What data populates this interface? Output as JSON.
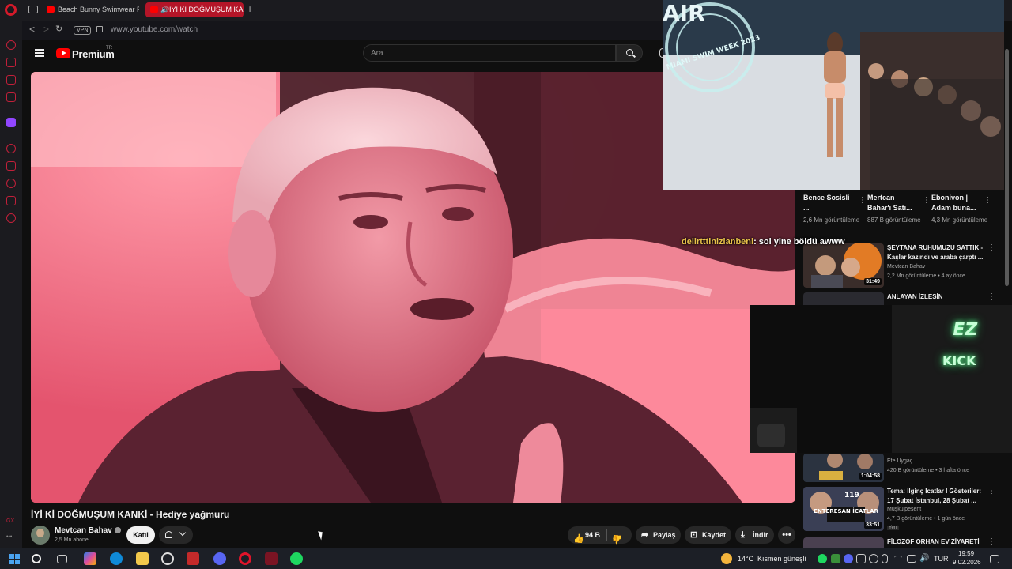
{
  "browser": {
    "tabs": [
      {
        "label": "Beach Bunny Swimwear Fa"
      },
      {
        "label": "İYİ Kİ DOĞMUŞUM KAN"
      }
    ],
    "vpn_label": "VPN",
    "url": "www.youtube.com/watch",
    "sidebar_labels": {
      "gx": "GX"
    }
  },
  "youtube": {
    "logo_text": "Premium",
    "logo_region": "TR",
    "search_placeholder": "Ara"
  },
  "video": {
    "title": "İYİ Kİ DOĞMUŞUM KANKİ - Hediye yağmuru",
    "channel": "Mevtcan Bahav",
    "subscribers": "2,5 Mn abone",
    "join_label": "Katıl",
    "likes": "94 B",
    "share_label": "Paylaş",
    "save_label": "Kaydet",
    "download_label": "İndir"
  },
  "shorts": [
    {
      "title": "Bence Sosisli ...",
      "views": "2,6 Mn görüntüleme"
    },
    {
      "title": "Mertcan Bahar'ı Satı...",
      "views": "887 B görüntüleme"
    },
    {
      "title": "Ebonivon | Adam buna...",
      "views": "4,3 Mn görüntüleme"
    }
  ],
  "recommendations": [
    {
      "title": "ŞEYTANA RUHUMUZU SATTIK - Kaşlar kazındı ve araba çarptı ...",
      "channel": "Mevtcan Bahav",
      "meta": "2,2 Mn görüntüleme • 4 ay önce",
      "duration": "31:49"
    },
    {
      "title": "ANLAYAN İZLESİN",
      "channel": "",
      "meta": "",
      "duration": ""
    },
    {
      "title": "",
      "channel": "Efe Uygaç",
      "meta": "420 B görüntüleme • 3 hafta önce",
      "duration": "1:04:58"
    },
    {
      "title": "Tema: İlginç İcatlar I Gösteriler: 17 Şubat İstanbul, 28 Şubat ...",
      "channel": "Müşkülpesent",
      "meta": "4,7 B görüntüleme • 1 gün önce",
      "badge": "Yeni",
      "duration": "33:51",
      "thumb_text": "ENTERESAN İCATLAR",
      "thumb_number": "119"
    },
    {
      "title": "FİLOZOF ORHAN EV ZİYARETİ",
      "channel": "",
      "meta": "",
      "duration": ""
    }
  ],
  "overlays": {
    "chat_user": "delirtttinizlanbeni",
    "chat_message": ": sol yine böldü awww",
    "cam_ez": "EZ",
    "cam_kick": "KICK",
    "pip_text": "AIR",
    "pip_stamp": "MIAMI SWIM WEEK 2023"
  },
  "taskbar": {
    "weather": "14°C",
    "weather_desc": "Kısmen güneşli",
    "lang": "TUR",
    "time": "19:59",
    "date": "9.02.2026"
  },
  "colors": {
    "accent": "#ff0000",
    "opera_red": "#d51a2a",
    "active_tab": "#b41528",
    "video_tint": "#e85a73",
    "chat_user": "#e8c24a",
    "neon": "#6bff9a"
  }
}
